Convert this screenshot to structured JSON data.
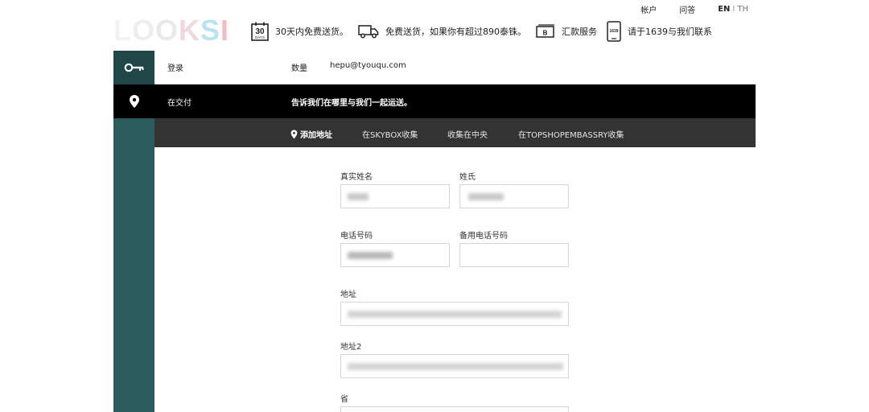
{
  "brand": {
    "logo": [
      "L",
      "O",
      "O",
      "K",
      "S",
      "I"
    ],
    "logo_colors": [
      "#f2f2f2",
      "#eeeeee",
      "#e9e9e9",
      "#f0d9de",
      "#b8e3ef",
      "#f3b9c6"
    ]
  },
  "top_links": {
    "account": "帐户",
    "faq": "问答",
    "lang_en": "EN",
    "lang_sep": "I",
    "lang_th": "TH"
  },
  "benefits": [
    {
      "icon": "calendar-30-icon",
      "icon_text": "30",
      "icon_sub": "DAYS",
      "text": "30天内免费送货。"
    },
    {
      "icon": "truck-icon",
      "text": "免费送货，如果你有超过890泰铢。"
    },
    {
      "icon": "cash-icon",
      "icon_text": "B",
      "text": "汇款服务"
    },
    {
      "icon": "phone-icon",
      "icon_text": "1639",
      "text": "请于1639与我们联系"
    }
  ],
  "steps": {
    "login": {
      "label": "登录",
      "qty_label": "数量",
      "email": "hepu@tyouqu.com",
      "icon": "key-icon"
    },
    "delivery": {
      "label": "在交付",
      "message": "告诉我们在哪里与我们一起运送。",
      "icon": "location-pin-icon"
    }
  },
  "delivery_tabs": [
    {
      "label": "添加地址",
      "active": true,
      "icon": "pin-icon"
    },
    {
      "label": "在SKYBOX收集",
      "active": false
    },
    {
      "label": "收集在中央",
      "active": false
    },
    {
      "label": "在TOPSHOPEMBASSRY收集",
      "active": false
    }
  ],
  "form": {
    "first_name_label": "真实姓名",
    "last_name_label": "姓氏",
    "phone_label": "电话号码",
    "alt_phone_label": "备用电话号码",
    "address_label": "地址",
    "address2_label": "地址2",
    "province_label": "省"
  },
  "colors": {
    "accent_teal": "#2b5c5c",
    "dark_bar": "#000000",
    "tab_bar": "#333333"
  }
}
